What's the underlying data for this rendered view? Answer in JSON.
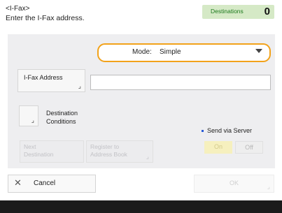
{
  "header": {
    "title": "<I-Fax>",
    "instruction": "Enter the I-Fax address."
  },
  "destinations": {
    "label": "Destinations",
    "count": "0"
  },
  "mode": {
    "label": "Mode:",
    "value": "Simple"
  },
  "ifax_address": {
    "button_label": "I-Fax Address",
    "value": ""
  },
  "destination_conditions": {
    "label_line1": "Destination",
    "label_line2": "Conditions"
  },
  "actions": {
    "next_line1": "Next",
    "next_line2": "Destination",
    "register_line1": "Register to",
    "register_line2": "Address Book"
  },
  "send_via_server": {
    "label": "Send via Server",
    "on_label": "On",
    "off_label": "Off",
    "selected": "On"
  },
  "footer": {
    "cancel_label": "Cancel",
    "ok_label": "OK"
  },
  "colors": {
    "accent": "#f2a21a",
    "badge_bg": "#d5e9c6",
    "badge_text": "#1c7a1c",
    "panel_bg": "#eeeef0"
  },
  "icons": {
    "cancel": "close-icon",
    "dropdown": "caret-down-icon",
    "corner": "corner-mark-icon"
  }
}
